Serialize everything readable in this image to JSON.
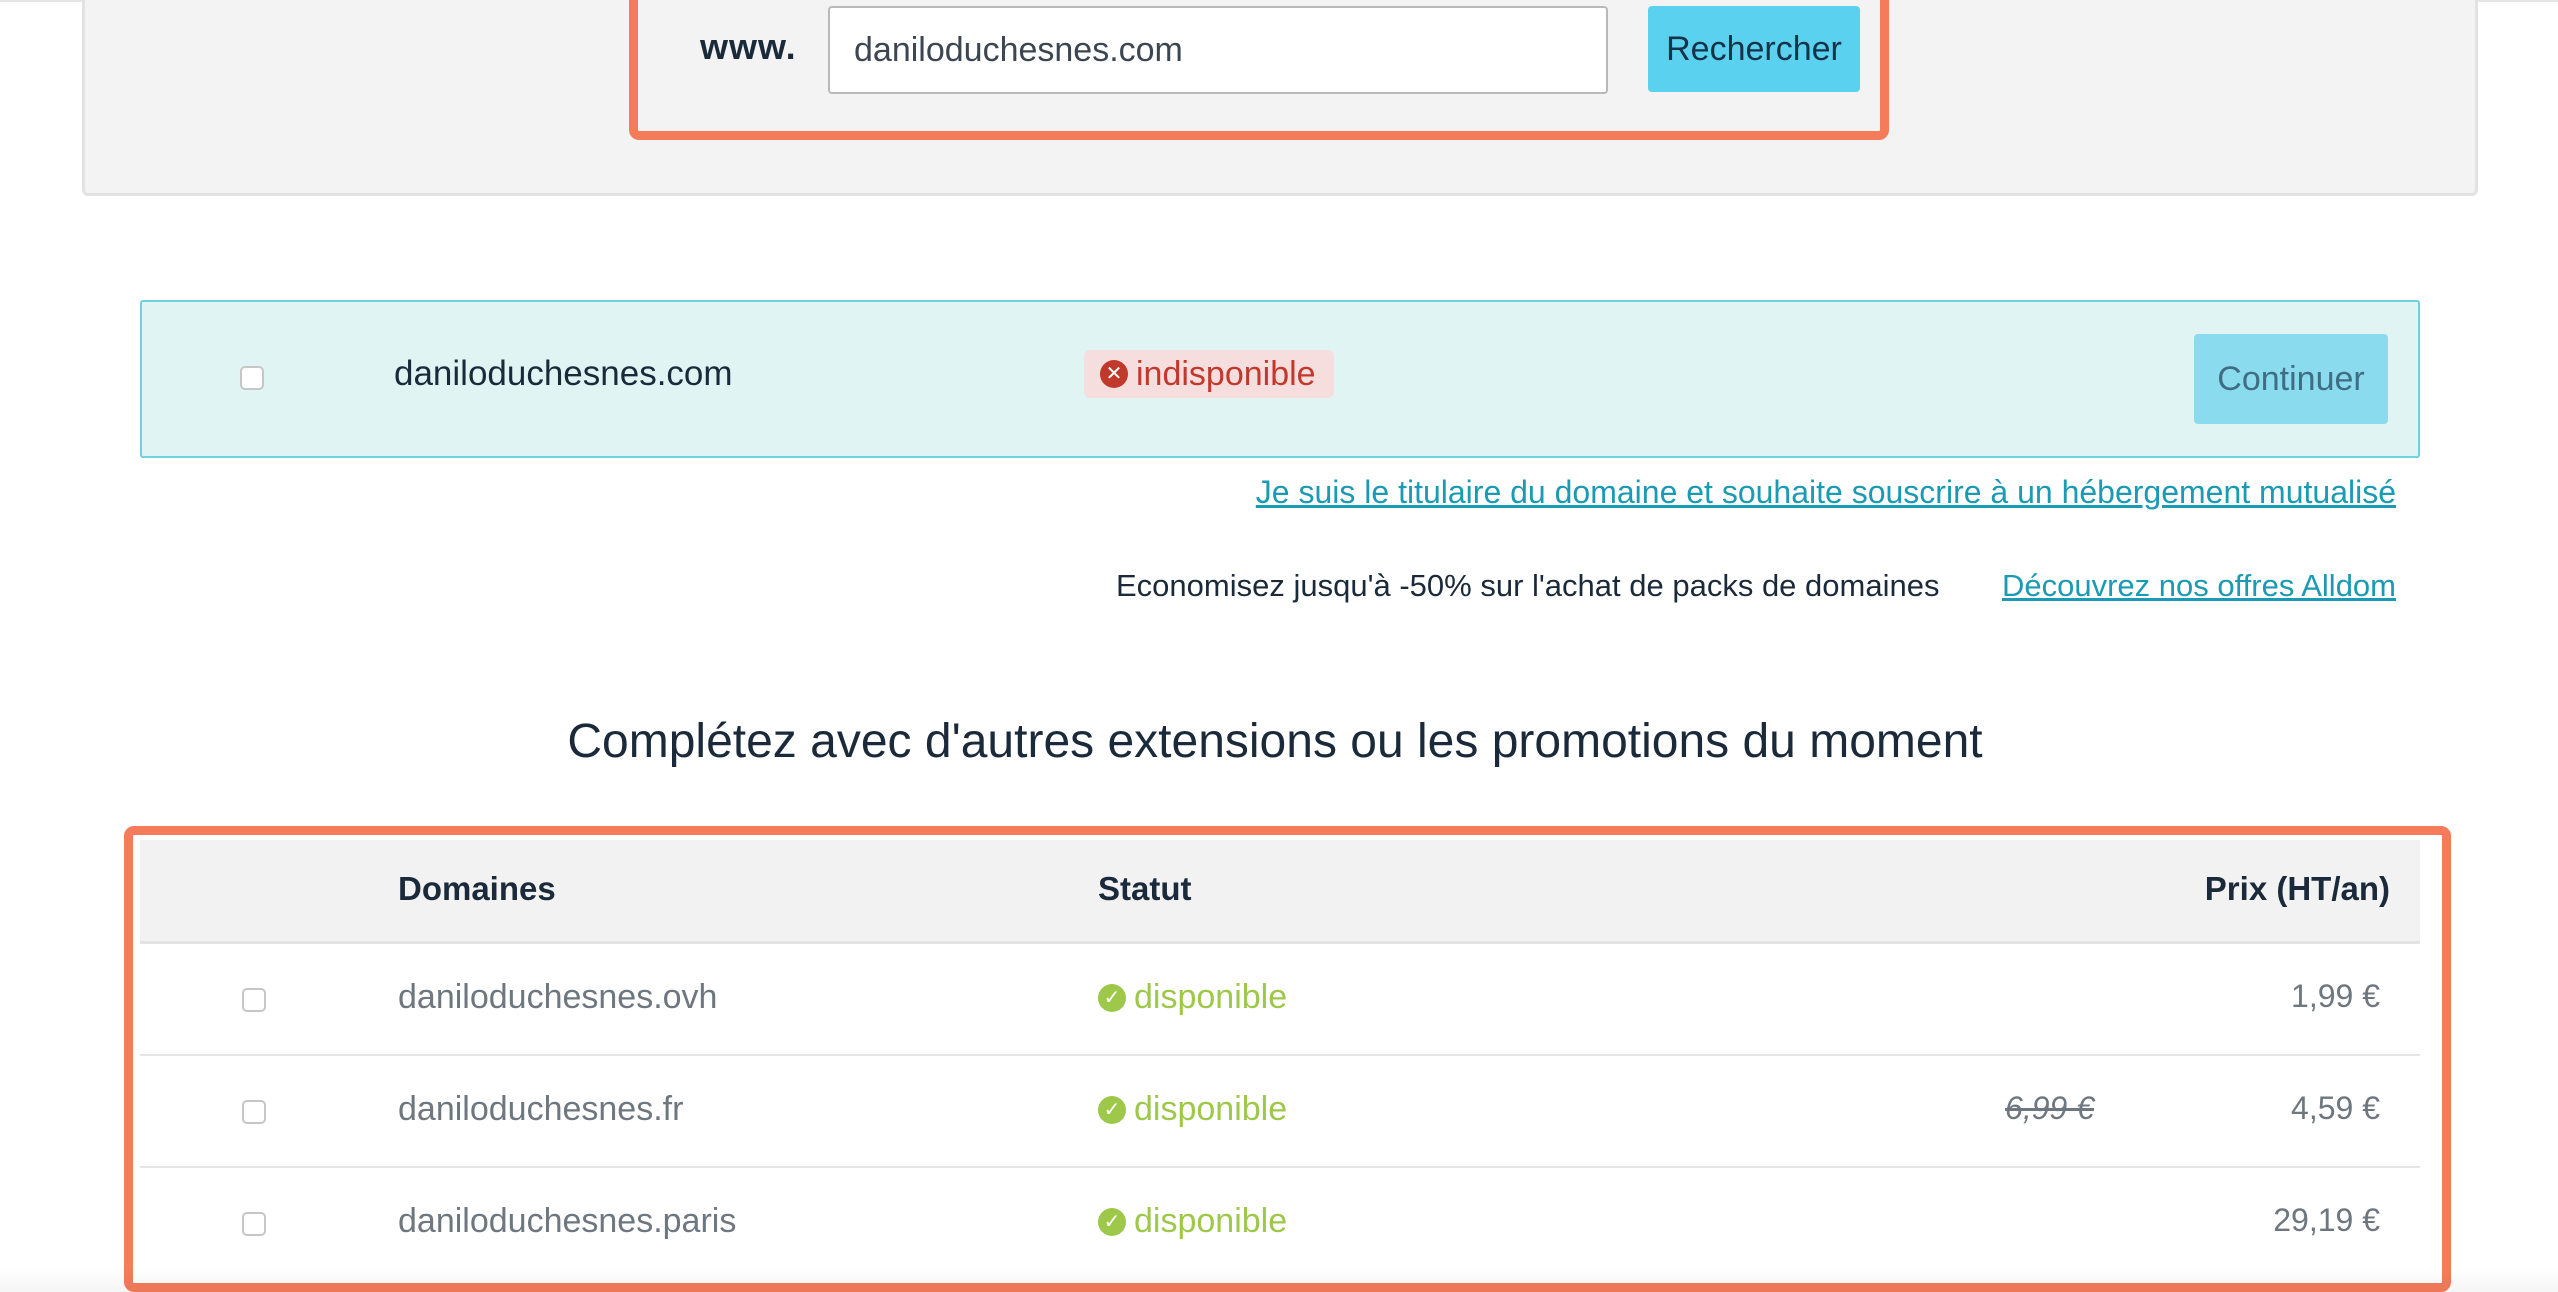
{
  "search": {
    "prefix_label": "www.",
    "query_value": "daniloduchesnes.com",
    "button_label": "Rechercher"
  },
  "result": {
    "domain": "daniloduchesnes.com",
    "status": "indisponible",
    "status_color": "#c0392b",
    "continue_label": "Continuer"
  },
  "links": {
    "hosting": "Je suis le titulaire du domaine et souhaite souscrire à un hébergement mutualisé",
    "promo_text": "Economisez jusqu'à -50% sur l'achat de packs de domaines",
    "promo_link": "Découvrez nos offres Alldom"
  },
  "extensions": {
    "title": "Complétez avec d'autres extensions ou les promotions du moment",
    "headers": {
      "domain": "Domaines",
      "status": "Statut",
      "price": "Prix (HT/an)"
    },
    "rows": [
      {
        "domain": "daniloduchesnes.ovh",
        "status": "disponible",
        "old_price": "",
        "price": "1,99 €"
      },
      {
        "domain": "daniloduchesnes.fr",
        "status": "disponible",
        "old_price": "6,99 €",
        "price": "4,59 €"
      },
      {
        "domain": "daniloduchesnes.paris",
        "status": "disponible",
        "old_price": "",
        "price": "29,19 €"
      }
    ]
  },
  "colors": {
    "accent": "#5ad1ee",
    "highlight": "#f47c5a",
    "available": "#9dc84a",
    "link": "#1a9bb3"
  }
}
